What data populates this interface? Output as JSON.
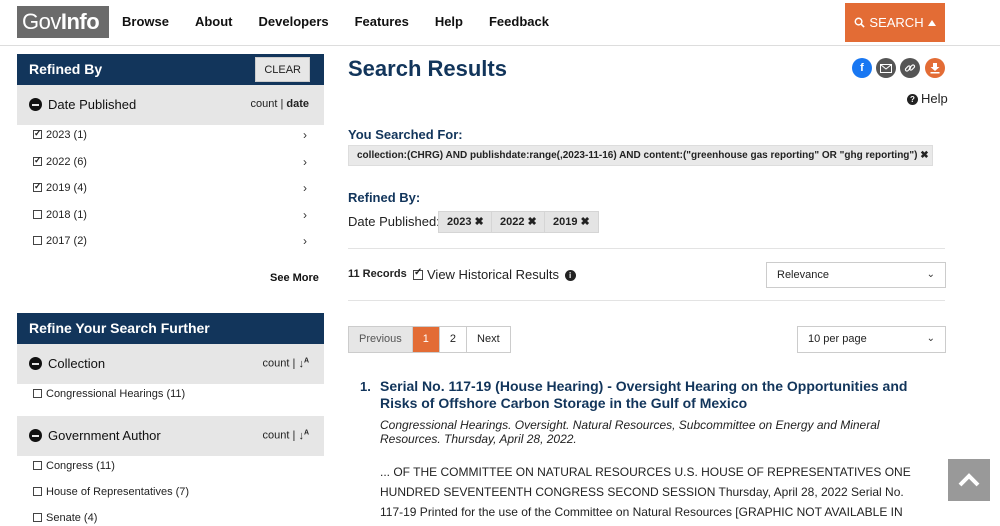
{
  "header": {
    "logo_light": "Gov",
    "logo_bold": "Info",
    "nav": [
      "Browse",
      "About",
      "Developers",
      "Features",
      "Help",
      "Feedback"
    ],
    "search_label": "SEARCH"
  },
  "sidebar": {
    "refined_title": "Refined By",
    "clear_label": "CLEAR",
    "date_facet": {
      "title": "Date Published",
      "sort_count": "count",
      "sort_sep": "|",
      "sort_date": "date",
      "items": [
        {
          "label": "2023 (1)",
          "checked": true
        },
        {
          "label": "2022 (6)",
          "checked": true
        },
        {
          "label": "2019 (4)",
          "checked": true
        },
        {
          "label": "2018 (1)",
          "checked": false
        },
        {
          "label": "2017 (2)",
          "checked": false
        }
      ],
      "see_more": "See More"
    },
    "refine_title": "Refine Your Search Further",
    "collection_facet": {
      "title": "Collection",
      "sort_count": "count",
      "sort_sep": "|",
      "items": [
        {
          "label": "Congressional Hearings (11)"
        }
      ]
    },
    "author_facet": {
      "title": "Government Author",
      "sort_count": "count",
      "sort_sep": "|",
      "items": [
        {
          "label": "Congress (11)"
        },
        {
          "label": "House of Representatives (7)"
        },
        {
          "label": "Senate (4)"
        }
      ]
    }
  },
  "main": {
    "title": "Search Results",
    "help_label": "Help",
    "searched_for_label": "You Searched For:",
    "query": "collection:(CHRG) AND publishdate:range(,2023-11-16) AND content:(\"greenhouse gas reporting\" OR \"ghg reporting\")",
    "refined_by_label": "Refined By:",
    "date_published_label": "Date Published:",
    "chips": [
      "2023",
      "2022",
      "2019"
    ],
    "records": "11 Records",
    "historical_label": "View Historical Results",
    "sort_select": "Relevance",
    "pager": {
      "prev": "Previous",
      "pages": [
        "1",
        "2"
      ],
      "next": "Next"
    },
    "per_page": "10 per page",
    "result": {
      "number": "1.",
      "title": "Serial No. 117-19 (House Hearing) - Oversight Hearing on the Opportunities and Risks of Offshore Carbon Storage in the Gulf of Mexico",
      "subtitle": "Congressional Hearings. Oversight. Natural Resources, Subcommittee on Energy and Mineral Resources. Thursday, April 28, 2022.",
      "snippet": "... OF THE COMMITTEE ON NATURAL RESOURCES U.S. HOUSE OF REPRESENTATIVES ONE HUNDRED SEVENTEENTH CONGRESS SECOND SESSION Thursday, April 28, 2022 Serial No. 117-19 Printed for the use of the Committee on Natural Resources [GRAPHIC NOT AVAILABLE IN TIFF FORMAT] Available via the World Wide Web: http://www.govinfo.gov or Committee address: http://"
    }
  },
  "colors": {
    "accent": "#e36c35",
    "navy": "#12355b",
    "facebook": "#1877f2"
  }
}
